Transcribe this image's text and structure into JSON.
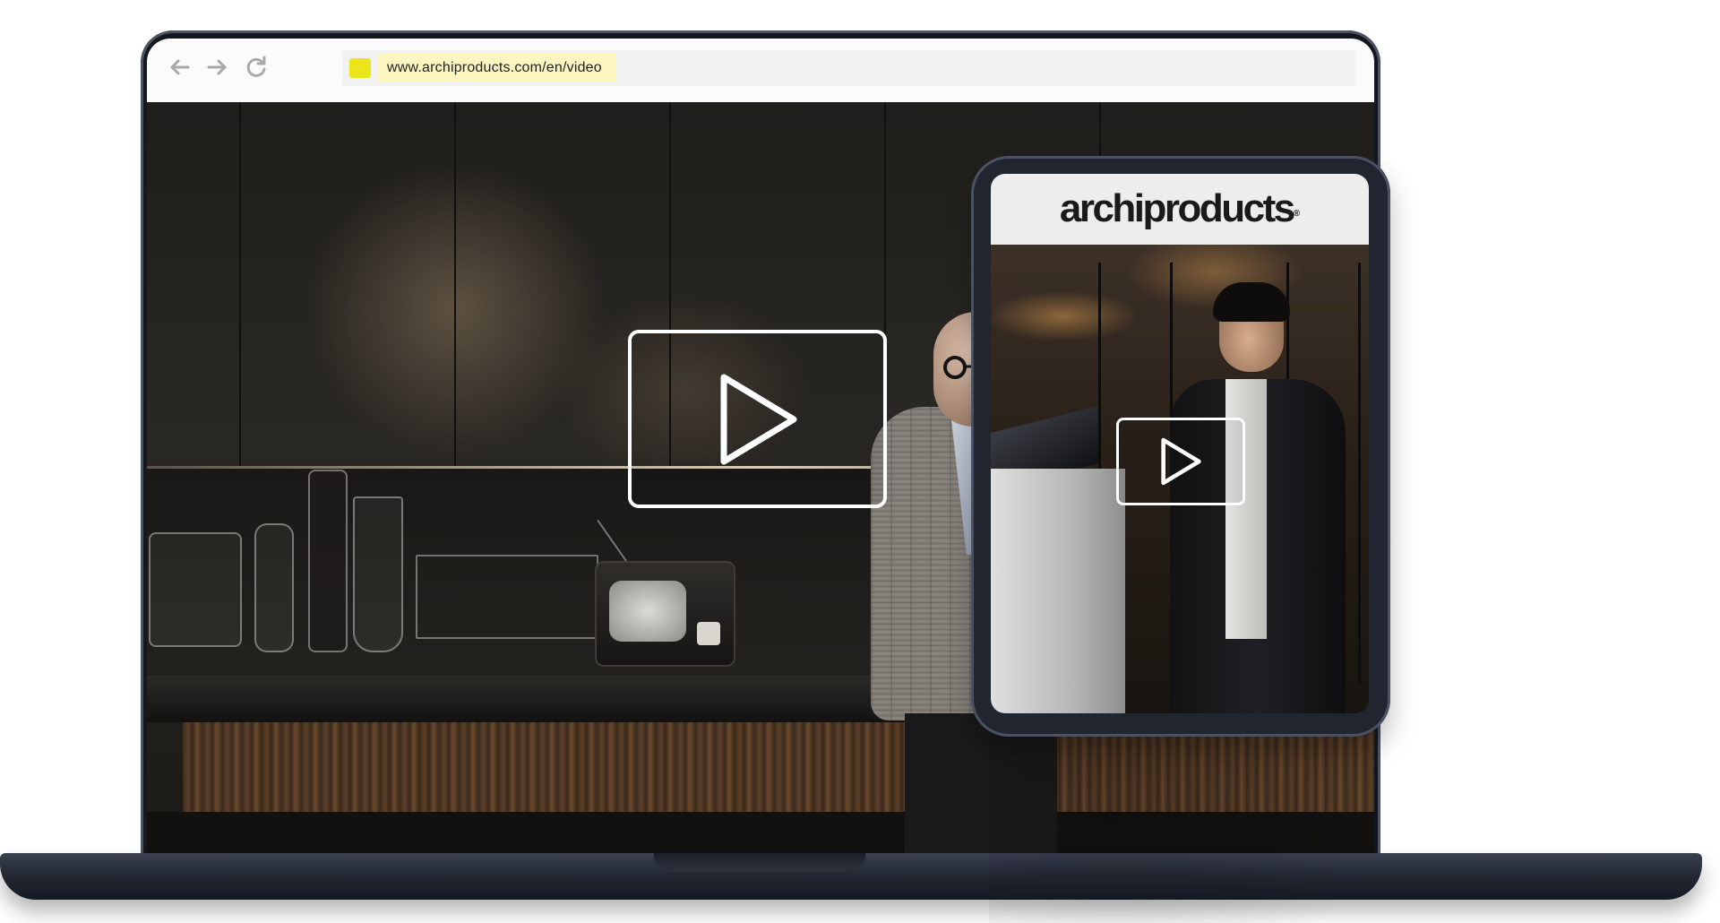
{
  "browser": {
    "url": "www.archiproducts.com/en/video",
    "nav": {
      "back_icon": "arrow-left-icon",
      "forward_icon": "arrow-right-icon",
      "reload_icon": "reload-icon"
    },
    "favicon_color": "#ece51a",
    "url_highlight_color": "#fbf6bf"
  },
  "laptop_video": {
    "play_icon": "play-icon"
  },
  "tablet": {
    "brand": "archiproducts",
    "brand_mark": "®",
    "play_icon": "play-icon"
  },
  "colors": {
    "device_frame": "#202530",
    "header_bg": "#ededed",
    "play_outline": "#ffffff"
  }
}
